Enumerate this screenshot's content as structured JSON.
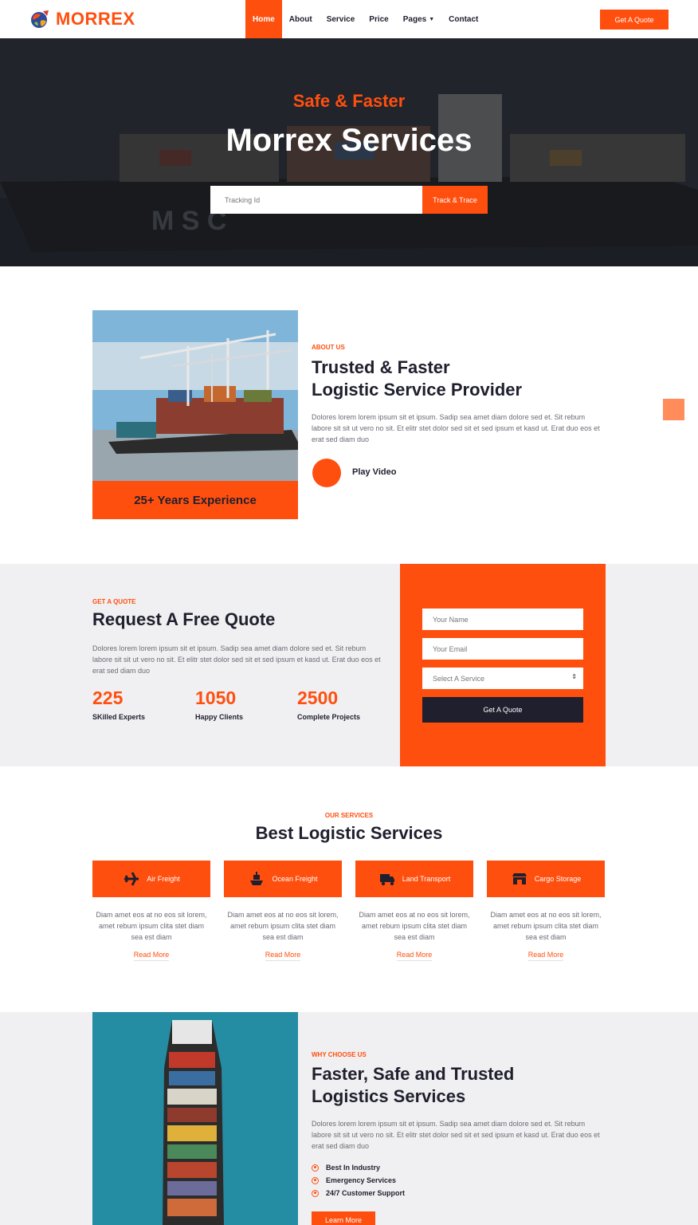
{
  "brand": {
    "name": "MORREX",
    "accent": "#ff4f0f",
    "dark": "#1f1f2e"
  },
  "nav": {
    "items": [
      {
        "label": "Home",
        "active": true
      },
      {
        "label": "About",
        "active": false
      },
      {
        "label": "Service",
        "active": false
      },
      {
        "label": "Price",
        "active": false
      },
      {
        "label": "Pages",
        "active": false,
        "dropdown": true
      },
      {
        "label": "Contact",
        "active": false
      }
    ],
    "cta_label": "Get A Quote"
  },
  "hero": {
    "subtitle": "Safe & Faster",
    "title": "Morrex Services",
    "tracking_placeholder": "Tracking Id",
    "track_button": "Track & Trace"
  },
  "about": {
    "label": "About Us",
    "title_line1": "Trusted & Faster",
    "title_line2": "Logistic Service Provider",
    "paragraph": "Dolores lorem lorem ipsum sit et ipsum. Sadip sea amet diam dolore sed et. Sit rebum labore sit sit ut vero no sit. Et elitr stet dolor sed sit et sed ipsum et kasd ut. Erat duo eos et erat sed diam duo",
    "experience": "25+ Years Experience",
    "play_label": "Play Video"
  },
  "quote": {
    "label": "Get A Quote",
    "title": "Request A Free Quote",
    "paragraph": "Dolores lorem lorem ipsum sit et ipsum. Sadip sea amet diam dolore sed et. Sit rebum labore sit sit ut vero no sit. Et elitr stet dolor sed sit et sed ipsum et kasd ut. Erat duo eos et erat sed diam duo",
    "stats": [
      {
        "value": "225",
        "label": "SKilled Experts"
      },
      {
        "value": "1050",
        "label": "Happy Clients"
      },
      {
        "value": "2500",
        "label": "Complete Projects"
      }
    ],
    "form": {
      "name_placeholder": "Your Name",
      "email_placeholder": "Your Email",
      "service_selected": "Select A Service",
      "submit_label": "Get A Quote"
    }
  },
  "services": {
    "label": "Our Services",
    "title": "Best Logistic Services",
    "items": [
      {
        "name": "Air Freight",
        "icon": "plane-icon",
        "description": "Diam amet eos at no eos sit lorem, amet rebum ipsum clita stet diam sea est diam",
        "link": "Read More"
      },
      {
        "name": "Ocean Freight",
        "icon": "ship-icon",
        "description": "Diam amet eos at no eos sit lorem, amet rebum ipsum clita stet diam sea est diam",
        "link": "Read More"
      },
      {
        "name": "Land Transport",
        "icon": "truck-icon",
        "description": "Diam amet eos at no eos sit lorem, amet rebum ipsum clita stet diam sea est diam",
        "link": "Read More"
      },
      {
        "name": "Cargo Storage",
        "icon": "warehouse-icon",
        "description": "Diam amet eos at no eos sit lorem, amet rebum ipsum clita stet diam sea est diam",
        "link": "Read More"
      }
    ]
  },
  "why": {
    "label": "Why Choose Us",
    "title_line1": "Faster, Safe and Trusted",
    "title_line2": "Logistics Services",
    "paragraph": "Dolores lorem lorem ipsum sit et ipsum. Sadip sea amet diam dolore sed et. Sit rebum labore sit sit ut vero no sit. Et elitr stet dolor sed sit et sed ipsum et kasd ut. Erat duo eos et erat sed diam duo",
    "points": [
      "Best In Industry",
      "Emergency Services",
      "24/7 Customer Support"
    ],
    "button": "Learn More"
  }
}
